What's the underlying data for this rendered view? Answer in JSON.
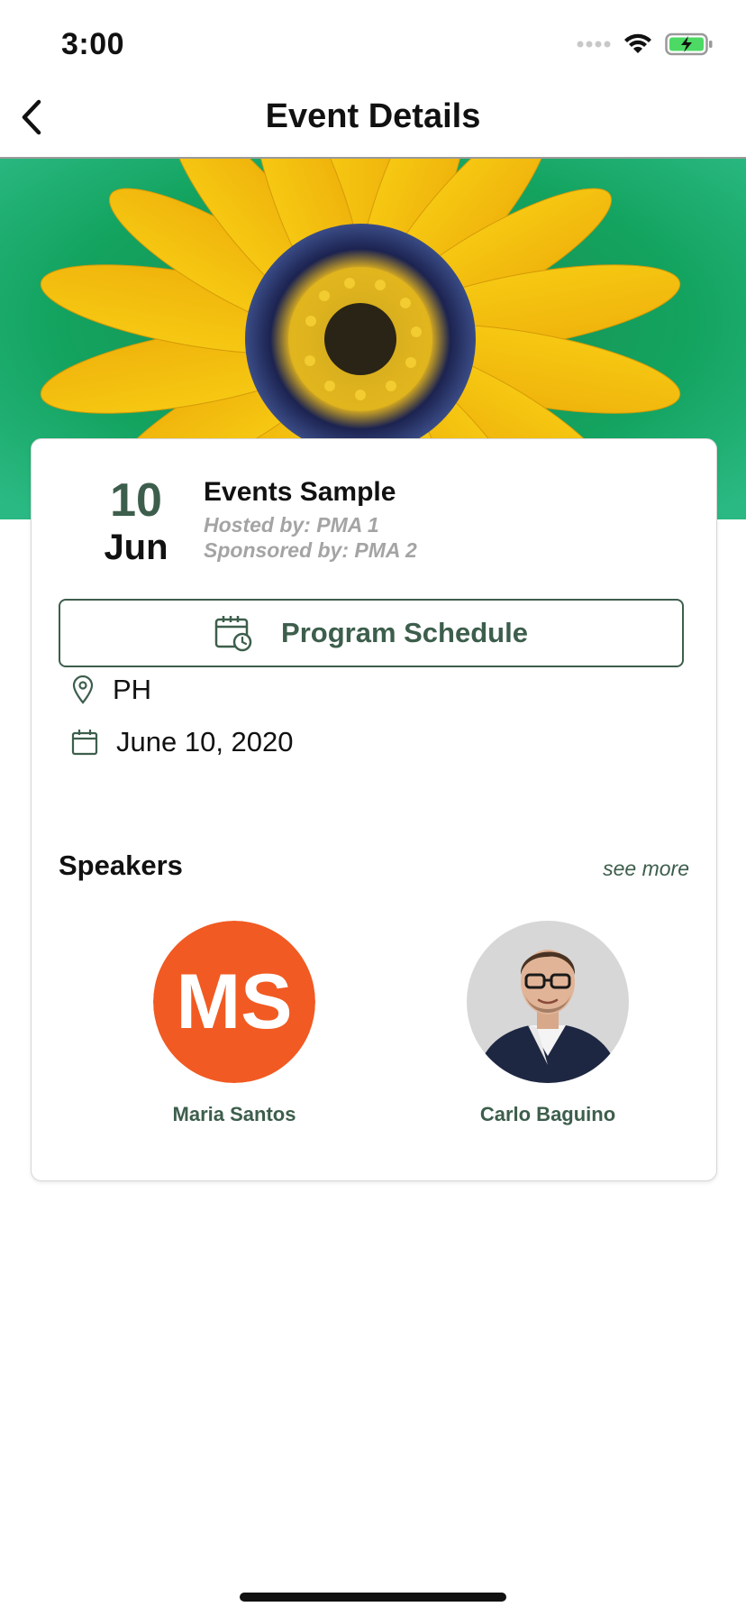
{
  "status_bar": {
    "time": "3:00"
  },
  "header": {
    "title": "Event Details"
  },
  "event": {
    "day": "10",
    "month": "Jun",
    "title": "Events Sample",
    "hosted_by": "Hosted by: PMA 1",
    "sponsored_by": "Sponsored by: PMA 2",
    "schedule_button": "Program Schedule",
    "location": "PH",
    "date": "June 10, 2020"
  },
  "speakers": {
    "heading": "Speakers",
    "see_more": "see more",
    "items": [
      {
        "name": "Maria Santos",
        "initials": "MS"
      },
      {
        "name": "Carlo Baguino"
      }
    ]
  },
  "colors": {
    "accent": "#3d5e4c",
    "avatar_orange": "#f15a22",
    "muted": "#a4a4a4"
  },
  "icons": [
    "back-chevron-icon",
    "signal-icon",
    "wifi-icon",
    "battery-icon",
    "calendar-clock-icon",
    "location-pin-icon",
    "calendar-icon"
  ]
}
